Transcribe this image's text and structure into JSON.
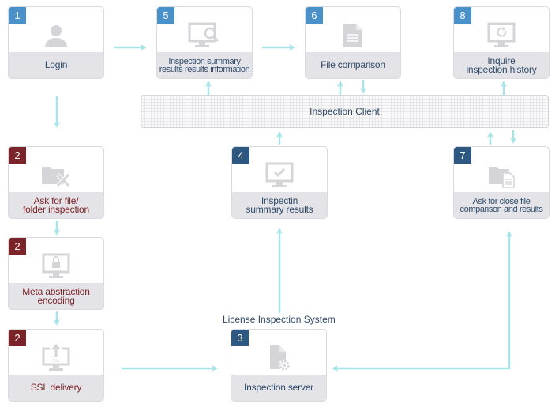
{
  "colors": {
    "arrow": "#a8e3e6",
    "badge_blue": "#4a90c9",
    "badge_red": "#7a2328",
    "badge_navy": "#2c5882",
    "label_bg": "#e4e4e8",
    "icon": "#d4d4d9"
  },
  "nodes": {
    "login": {
      "step": "1",
      "icon": "user-icon",
      "lines": [
        "Login"
      ]
    },
    "summary_info": {
      "step": "5",
      "icon": "monitor-search-icon",
      "lines": [
        "Inspection summary",
        "results results information"
      ]
    },
    "file_comparison": {
      "step": "6",
      "icon": "document-icon",
      "lines": [
        "File comparison"
      ]
    },
    "inquire_history": {
      "step": "8",
      "icon": "monitor-refresh-icon",
      "lines": [
        "Inquire",
        "inspection history"
      ]
    },
    "ask_folder": {
      "step": "2",
      "icon": "folder-tools-icon",
      "lines": [
        "Ask for file/",
        "folder inspection"
      ]
    },
    "meta_encoding": {
      "step": "2",
      "icon": "monitor-lock-icon",
      "lines": [
        "Meta abstraction",
        "encoding"
      ]
    },
    "ssl_delivery": {
      "step": "2",
      "icon": "monitor-upload-ssl-icon",
      "icon_text": "SSL",
      "lines": [
        "SSL delivery"
      ]
    },
    "summary_results": {
      "step": "4",
      "icon": "monitor-check-icon",
      "lines": [
        "Inspectin",
        "summary results"
      ]
    },
    "close_comparison": {
      "step": "7",
      "icon": "folder-document-icon",
      "lines": [
        "Ask for close file",
        "comparison and results"
      ]
    },
    "inspection_server": {
      "step": "3",
      "icon": "document-gear-icon",
      "lines": [
        "Inspection server"
      ]
    }
  },
  "client": {
    "label": "Inspection Client"
  },
  "system": {
    "label": "License Inspection System"
  }
}
